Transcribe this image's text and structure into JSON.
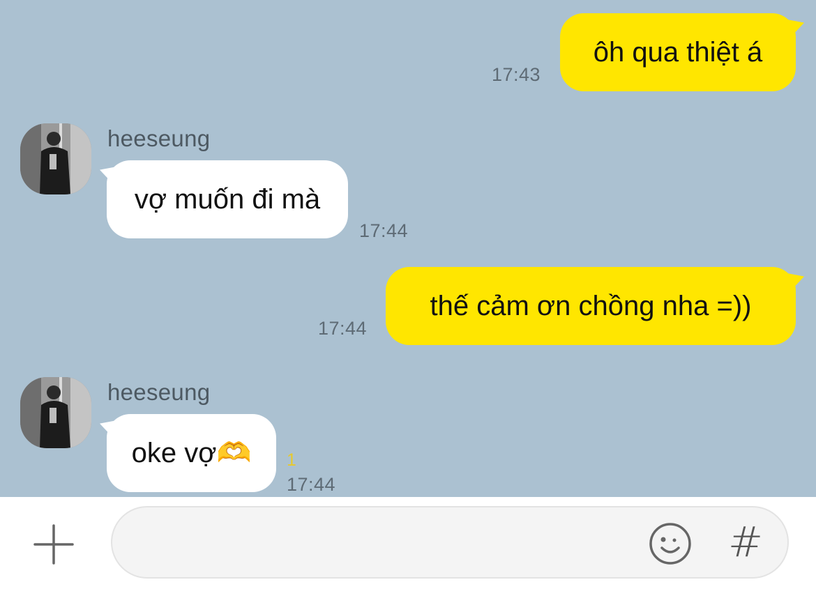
{
  "conversation": {
    "messages": [
      {
        "id": "m1",
        "direction": "outgoing",
        "text": "ôh qua thiệt á",
        "time": "17:43"
      },
      {
        "id": "m2",
        "direction": "incoming",
        "sender": "heeseung",
        "text": "vợ muốn đi mà",
        "time": "17:44"
      },
      {
        "id": "m3",
        "direction": "outgoing",
        "text": "thế cảm ơn chồng nha =))",
        "time": "17:44"
      },
      {
        "id": "m4",
        "direction": "incoming",
        "sender": "heeseung",
        "text": "oke vợ🫶",
        "time": "17:44",
        "unread_count": "1"
      }
    ]
  },
  "composer": {
    "input_value": "",
    "input_placeholder": "",
    "hash_label": "#"
  },
  "colors": {
    "background": "#abc1d1",
    "outgoing_bubble": "#ffe600",
    "incoming_bubble": "#ffffff",
    "unread": "#e7c92d"
  },
  "icons": {
    "add": "plus-icon",
    "emoji": "smiley-icon",
    "hashtag": "hash-icon"
  }
}
